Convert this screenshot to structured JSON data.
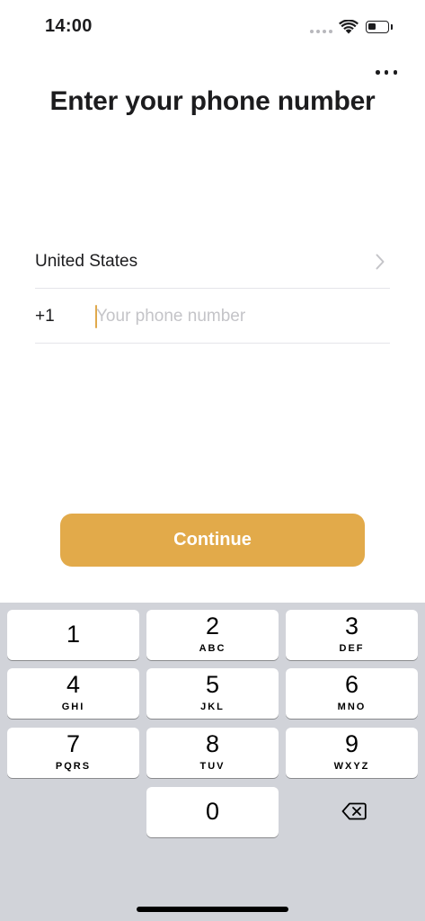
{
  "status_bar": {
    "time": "14:00",
    "battery_level": 0.4,
    "icons": [
      "signal-dots-icon",
      "wifi-icon",
      "battery-icon"
    ]
  },
  "header": {
    "more_icon": "more-horizontal-icon",
    "title": "Enter your phone number"
  },
  "form": {
    "country": "United States",
    "country_code": "+1",
    "phone_value": "",
    "phone_placeholder": "Your phone number"
  },
  "continue_label": "Continue",
  "colors": {
    "accent": "#e2aa4a",
    "caret": "#e0a94c",
    "keypad_background": "#d1d3d9"
  },
  "keypad": {
    "keys": [
      {
        "digit": "1",
        "letters": ""
      },
      {
        "digit": "2",
        "letters": "ABC"
      },
      {
        "digit": "3",
        "letters": "DEF"
      },
      {
        "digit": "4",
        "letters": "GHI"
      },
      {
        "digit": "5",
        "letters": "JKL"
      },
      {
        "digit": "6",
        "letters": "MNO"
      },
      {
        "digit": "7",
        "letters": "PQRS"
      },
      {
        "digit": "8",
        "letters": "TUV"
      },
      {
        "digit": "9",
        "letters": "WXYZ"
      },
      {
        "digit": "0",
        "letters": ""
      }
    ],
    "delete_icon": "backspace-icon"
  }
}
